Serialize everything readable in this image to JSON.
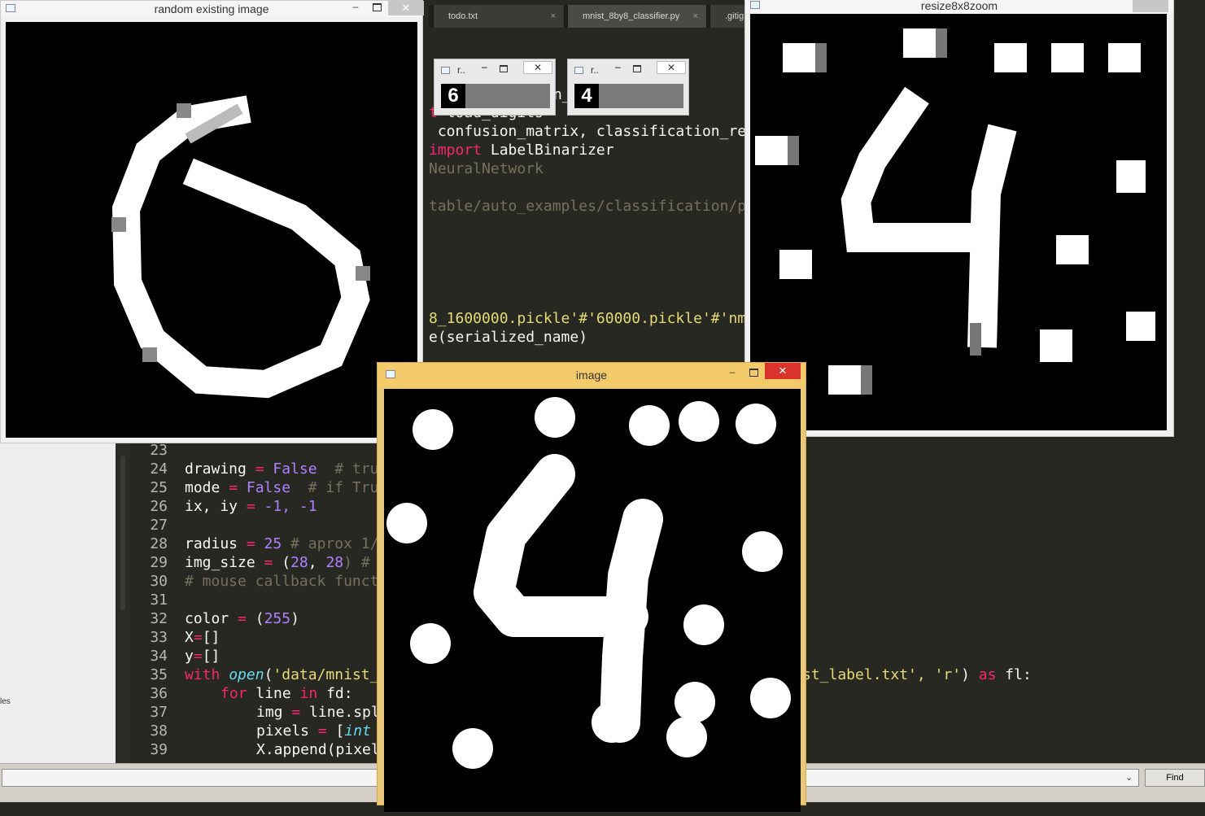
{
  "editor": {
    "tabs": [
      {
        "label": "todo.txt",
        "close": "×"
      },
      {
        "label": "mnist_8by8_classifier.py",
        "close": "×"
      },
      {
        "label": ".gitign",
        "close": ""
      }
    ],
    "top_code": [
      {
        "pre": "",
        "kw": "",
        "rest": "n_"
      },
      {
        "pre": "",
        "kw": "t",
        "rest": " load_digits"
      },
      {
        "pre": "",
        "kw": "",
        "rest": " confusion_matrix, classification_re"
      },
      {
        "pre": "",
        "kw": "import",
        "rest": " LabelBinarizer"
      },
      {
        "pre": "",
        "kw": "",
        "rest": "NeuralNetwork"
      },
      {
        "pre": "",
        "kw": "",
        "rest": "table/auto_examples/classification/p"
      },
      {
        "pre": "",
        "kw": "",
        "rest": "8_1600000.pickle'#'60000.pickle'#'nm"
      },
      {
        "pre": "",
        "kw": "",
        "rest": "e(serialized_name)"
      }
    ],
    "line_numbers": [
      "23",
      "24",
      "25",
      "26",
      "27",
      "28",
      "29",
      "30",
      "31",
      "32",
      "33",
      "34",
      "35",
      "36",
      "37",
      "38",
      "39"
    ],
    "lines": {
      "l24": {
        "a": "drawing ",
        "op": "=",
        "b": " False",
        "c": "  # tru"
      },
      "l25": {
        "a": "mode ",
        "op": "=",
        "b": " False",
        "c": "  # if Tru"
      },
      "l26": {
        "a": "ix, iy ",
        "op": "=",
        "b": " -1, -1"
      },
      "l28": {
        "a": "radius ",
        "op": "=",
        "b": " 25",
        "c": " # aprox 1/"
      },
      "l29": {
        "a": "img_size ",
        "op": "=",
        "b": " (",
        "n": "28",
        "m": ", ",
        "n2": "28",
        "e": ") #"
      },
      "l30": {
        "c": "# mouse callback funct"
      },
      "l32": {
        "a": "color ",
        "op": "=",
        "b": " (",
        "n": "255",
        "e": ")"
      },
      "l33": {
        "a": "X",
        "op": "=",
        "e": "[]"
      },
      "l34": {
        "a": "y",
        "op": "=",
        "e": "[]"
      },
      "l35": {
        "kw": "with",
        "fn": "open",
        "s": "'data/mnist_",
        "tail1": "st_label.txt', ",
        "s2": "'r'",
        "tail2": ") ",
        "kw2": "as",
        "tail3": " fl:"
      },
      "l36": {
        "kw": "for",
        "a": " line ",
        "kw2": "in",
        "b": " fd:"
      },
      "l37": {
        "a": "img ",
        "op": "=",
        "b": " line.spl"
      },
      "l38": {
        "a": "pixels ",
        "op": "=",
        "b": " [",
        "fn": "int"
      },
      "l39": {
        "a": "X.append(pixel"
      }
    },
    "sidebar_text": "les"
  },
  "findbar": {
    "find_label": "Find",
    "dropdown_caret": "⌄"
  },
  "windows": {
    "random": {
      "title": "random existing image"
    },
    "resize": {
      "title": "resize8x8zoom"
    },
    "image": {
      "title": "image"
    },
    "mini1": {
      "title": "r..",
      "thumb": "6"
    },
    "mini2": {
      "title": "r..",
      "thumb": "4"
    }
  },
  "controls": {
    "minimize": "–",
    "close": "✕"
  },
  "colors": {
    "editor_bg": "#272822",
    "keyword": "#f92672",
    "number": "#ae81ff",
    "string": "#e6db74",
    "comment": "#75715e",
    "function": "#66d9ef",
    "active_title": "#f3ca6a",
    "close_red": "#d9332b"
  }
}
